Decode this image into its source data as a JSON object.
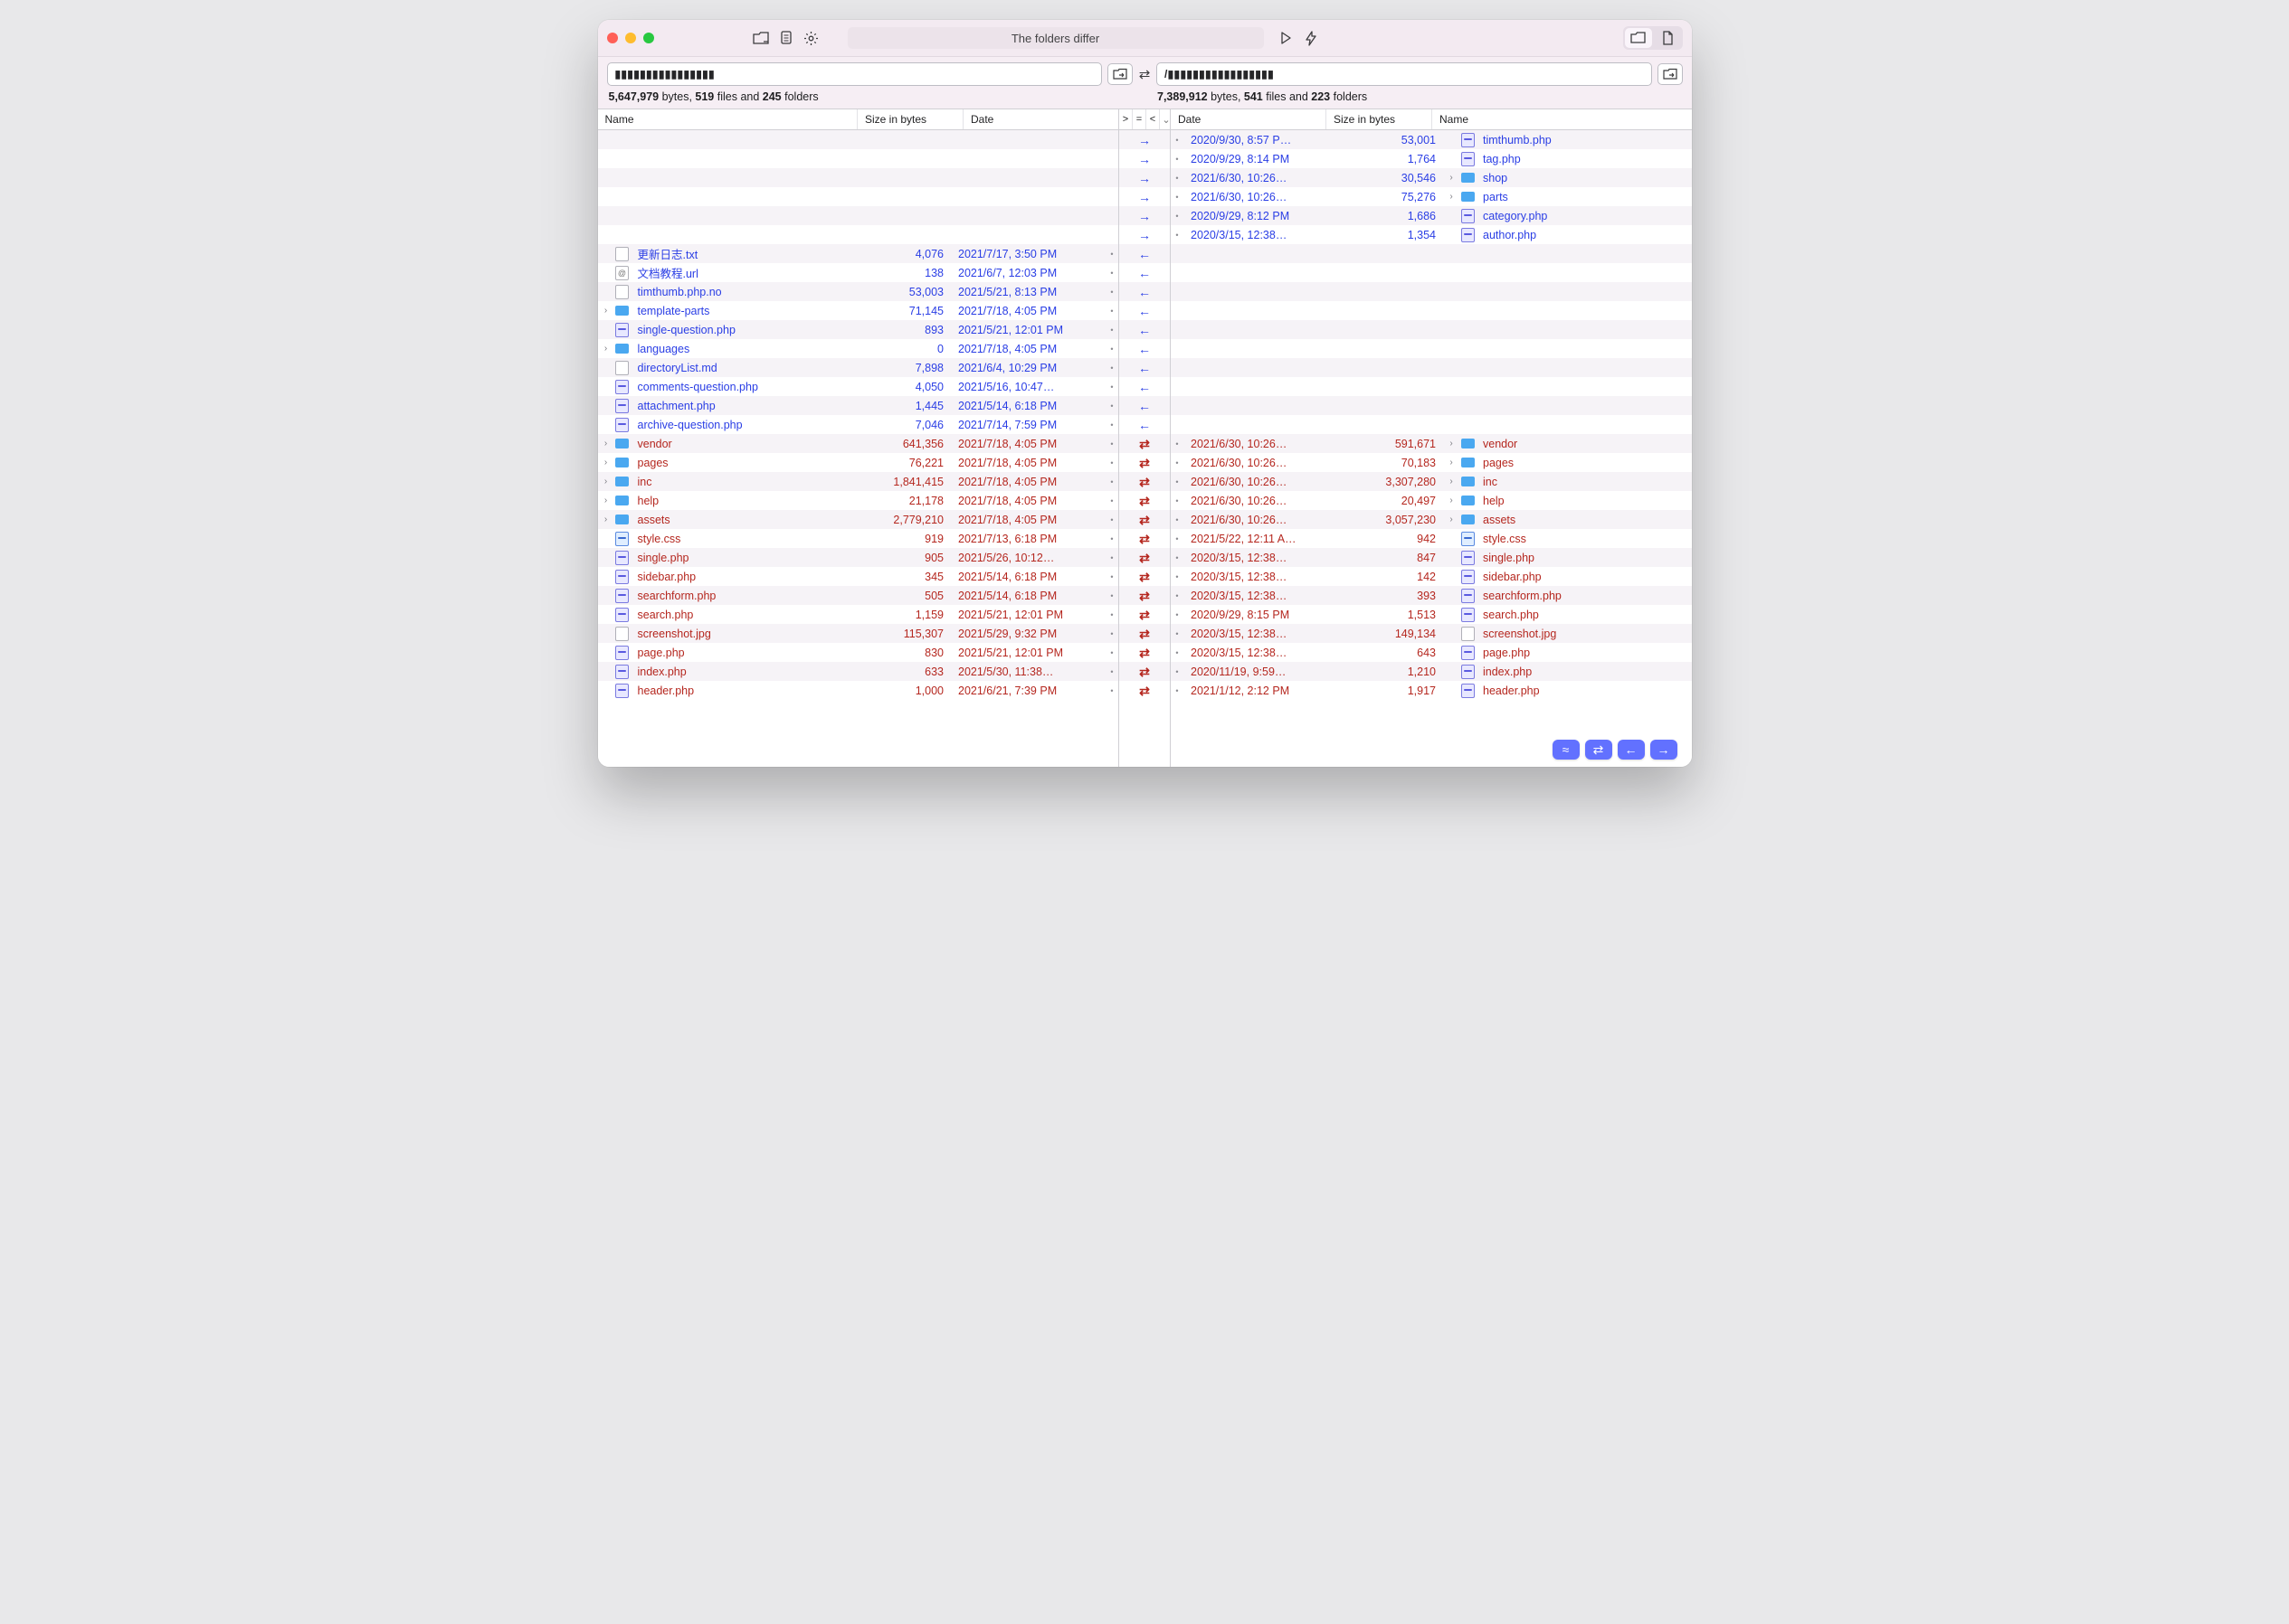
{
  "titlebar": {
    "status": "The folders differ"
  },
  "left_path": "▮▮▮▮▮▮▮▮▮▮▮▮▮▮▮▮",
  "right_path": "/▮▮▮▮▮▮▮▮▮▮▮▮▮▮▮▮▮",
  "left_stats": {
    "bytes": "5,647,979",
    "files": "519",
    "folders": "245"
  },
  "right_stats": {
    "bytes": "7,389,912",
    "files": "541",
    "folders": "223"
  },
  "columns": {
    "name": "Name",
    "size": "Size in bytes",
    "date": "Date",
    "gt": ">",
    "eq": "=",
    "lt": "<"
  },
  "rows": [
    {
      "sym": "→",
      "color": "blue",
      "right": {
        "date": "2020/9/30, 8:57 P…",
        "size": "53,001",
        "icon": "php",
        "name": "timthumb.php"
      }
    },
    {
      "sym": "→",
      "color": "blue",
      "right": {
        "date": "2020/9/29, 8:14 PM",
        "size": "1,764",
        "icon": "php",
        "name": "tag.php"
      }
    },
    {
      "sym": "→",
      "color": "blue",
      "right": {
        "date": "2021/6/30, 10:26…",
        "size": "30,546",
        "icon": "folder",
        "tw": "›",
        "name": "shop"
      }
    },
    {
      "sym": "→",
      "color": "blue",
      "right": {
        "date": "2021/6/30, 10:26…",
        "size": "75,276",
        "icon": "folder",
        "tw": "›",
        "name": "parts"
      }
    },
    {
      "sym": "→",
      "color": "blue",
      "right": {
        "date": "2020/9/29, 8:12 PM",
        "size": "1,686",
        "icon": "php",
        "name": "category.php"
      }
    },
    {
      "sym": "→",
      "color": "blue",
      "right": {
        "date": "2020/3/15, 12:38…",
        "size": "1,354",
        "icon": "php",
        "name": "author.php"
      }
    },
    {
      "sym": "←",
      "color": "blue",
      "left": {
        "icon": "txt",
        "name": "更新日志.txt",
        "size": "4,076",
        "date": "2021/7/17, 3:50 PM"
      }
    },
    {
      "sym": "←",
      "color": "blue",
      "left": {
        "icon": "url",
        "name": "文档教程.url",
        "size": "138",
        "date": "2021/6/7, 12:03 PM"
      }
    },
    {
      "sym": "←",
      "color": "blue",
      "left": {
        "icon": "txt",
        "name": "timthumb.php.no",
        "size": "53,003",
        "date": "2021/5/21, 8:13 PM"
      }
    },
    {
      "sym": "←",
      "color": "blue",
      "left": {
        "tw": "›",
        "icon": "folder",
        "name": "template-parts",
        "size": "71,145",
        "date": "2021/7/18, 4:05 PM"
      }
    },
    {
      "sym": "←",
      "color": "blue",
      "left": {
        "icon": "php",
        "name": "single-question.php",
        "size": "893",
        "date": "2021/5/21, 12:01 PM"
      }
    },
    {
      "sym": "←",
      "color": "blue",
      "left": {
        "tw": "›",
        "icon": "folder",
        "name": "languages",
        "size": "0",
        "date": "2021/7/18, 4:05 PM"
      }
    },
    {
      "sym": "←",
      "color": "blue",
      "left": {
        "icon": "txt",
        "name": "directoryList.md",
        "size": "7,898",
        "date": "2021/6/4, 10:29 PM"
      }
    },
    {
      "sym": "←",
      "color": "blue",
      "left": {
        "icon": "php",
        "name": "comments-question.php",
        "size": "4,050",
        "date": "2021/5/16, 10:47…"
      }
    },
    {
      "sym": "←",
      "color": "blue",
      "left": {
        "icon": "php",
        "name": "attachment.php",
        "size": "1,445",
        "date": "2021/5/14, 6:18 PM"
      }
    },
    {
      "sym": "←",
      "color": "blue",
      "left": {
        "icon": "php",
        "name": "archive-question.php",
        "size": "7,046",
        "date": "2021/7/14, 7:59 PM"
      }
    },
    {
      "sym": "⇄",
      "color": "red",
      "left": {
        "tw": "›",
        "icon": "folder",
        "name": "vendor",
        "size": "641,356",
        "date": "2021/7/18, 4:05 PM"
      },
      "right": {
        "date": "2021/6/30, 10:26…",
        "size": "591,671",
        "tw": "›",
        "icon": "folder",
        "name": "vendor"
      }
    },
    {
      "sym": "⇄",
      "color": "red",
      "left": {
        "tw": "›",
        "icon": "folder",
        "name": "pages",
        "size": "76,221",
        "date": "2021/7/18, 4:05 PM"
      },
      "right": {
        "date": "2021/6/30, 10:26…",
        "size": "70,183",
        "tw": "›",
        "icon": "folder",
        "name": "pages"
      }
    },
    {
      "sym": "⇄",
      "color": "red",
      "left": {
        "tw": "›",
        "icon": "folder",
        "name": "inc",
        "size": "1,841,415",
        "date": "2021/7/18, 4:05 PM"
      },
      "right": {
        "date": "2021/6/30, 10:26…",
        "size": "3,307,280",
        "tw": "›",
        "icon": "folder",
        "name": "inc"
      }
    },
    {
      "sym": "⇄",
      "color": "red",
      "left": {
        "tw": "›",
        "icon": "folder",
        "name": "help",
        "size": "21,178",
        "date": "2021/7/18, 4:05 PM"
      },
      "right": {
        "date": "2021/6/30, 10:26…",
        "size": "20,497",
        "tw": "›",
        "icon": "folder",
        "name": "help"
      }
    },
    {
      "sym": "⇄",
      "color": "red",
      "left": {
        "tw": "›",
        "icon": "folder",
        "name": "assets",
        "size": "2,779,210",
        "date": "2021/7/18, 4:05 PM"
      },
      "right": {
        "date": "2021/6/30, 10:26…",
        "size": "3,057,230",
        "tw": "›",
        "icon": "folder",
        "name": "assets"
      }
    },
    {
      "sym": "⇄",
      "color": "red",
      "left": {
        "icon": "css",
        "name": "style.css",
        "size": "919",
        "date": "2021/7/13, 6:18 PM"
      },
      "right": {
        "date": "2021/5/22, 12:11 A…",
        "size": "942",
        "icon": "css",
        "name": "style.css"
      }
    },
    {
      "sym": "⇄",
      "color": "red",
      "left": {
        "icon": "php",
        "name": "single.php",
        "size": "905",
        "date": "2021/5/26, 10:12…"
      },
      "right": {
        "date": "2020/3/15, 12:38…",
        "size": "847",
        "icon": "php",
        "name": "single.php"
      }
    },
    {
      "sym": "⇄",
      "color": "red",
      "left": {
        "icon": "php",
        "name": "sidebar.php",
        "size": "345",
        "date": "2021/5/14, 6:18 PM"
      },
      "right": {
        "date": "2020/3/15, 12:38…",
        "size": "142",
        "icon": "php",
        "name": "sidebar.php"
      }
    },
    {
      "sym": "⇄",
      "color": "red",
      "left": {
        "icon": "php",
        "name": "searchform.php",
        "size": "505",
        "date": "2021/5/14, 6:18 PM"
      },
      "right": {
        "date": "2020/3/15, 12:38…",
        "size": "393",
        "icon": "php",
        "name": "searchform.php"
      }
    },
    {
      "sym": "⇄",
      "color": "red",
      "left": {
        "icon": "php",
        "name": "search.php",
        "size": "1,159",
        "date": "2021/5/21, 12:01 PM"
      },
      "right": {
        "date": "2020/9/29, 8:15 PM",
        "size": "1,513",
        "icon": "php",
        "name": "search.php"
      }
    },
    {
      "sym": "⇄",
      "color": "red",
      "left": {
        "icon": "img",
        "name": "screenshot.jpg",
        "size": "115,307",
        "date": "2021/5/29, 9:32 PM"
      },
      "right": {
        "date": "2020/3/15, 12:38…",
        "size": "149,134",
        "icon": "img",
        "name": "screenshot.jpg"
      }
    },
    {
      "sym": "⇄",
      "color": "red",
      "left": {
        "icon": "php",
        "name": "page.php",
        "size": "830",
        "date": "2021/5/21, 12:01 PM"
      },
      "right": {
        "date": "2020/3/15, 12:38…",
        "size": "643",
        "icon": "php",
        "name": "page.php"
      }
    },
    {
      "sym": "⇄",
      "color": "red",
      "left": {
        "icon": "php",
        "name": "index.php",
        "size": "633",
        "date": "2021/5/30, 11:38…"
      },
      "right": {
        "date": "2020/11/19, 9:59…",
        "size": "1,210",
        "icon": "php",
        "name": "index.php"
      }
    },
    {
      "sym": "⇄",
      "color": "red",
      "left": {
        "icon": "php",
        "name": "header.php",
        "size": "1,000",
        "date": "2021/6/21, 7:39 PM"
      },
      "right": {
        "date": "2021/1/12, 2:12 PM",
        "size": "1,917",
        "icon": "php",
        "name": "header.php"
      }
    }
  ]
}
